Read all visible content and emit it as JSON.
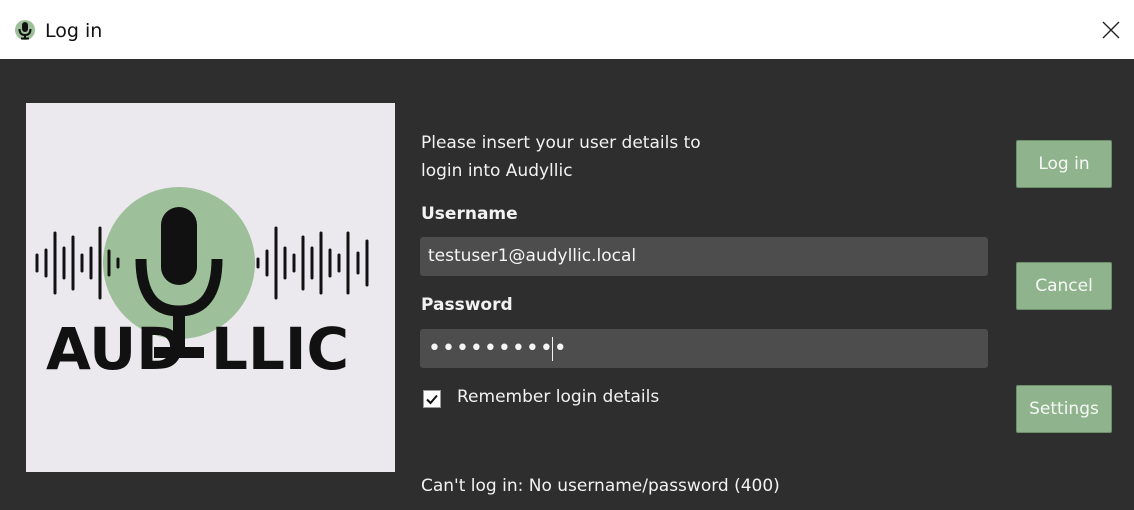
{
  "window": {
    "title": "Log in",
    "icon": "microphone-icon",
    "close_icon": "close-icon"
  },
  "logo": {
    "text": "AUD  LLIC",
    "circle_color": "#9dbf99",
    "mic_color": "#111111"
  },
  "form": {
    "intro_line1": "Please insert your user details to",
    "intro_line2": "login into Audyllic",
    "username_label": "Username",
    "username_value": "testuser1@audyllic.local",
    "password_label": "Password",
    "password_mask": "••••••••••",
    "remember_label": "Remember login details",
    "remember_checked": true,
    "status_text": "Can't log in: No username/password (400)"
  },
  "buttons": {
    "login": "Log in",
    "cancel": "Cancel",
    "settings": "Settings"
  },
  "colors": {
    "background": "#2e2e2e",
    "field": "#4d4d4d",
    "button": "#8fb38c",
    "text": "#f2f2f2"
  }
}
